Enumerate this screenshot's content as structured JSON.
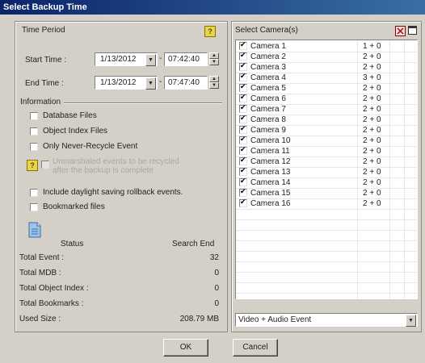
{
  "window": {
    "title": "Select Backup Time"
  },
  "time_period": {
    "title": "Time Period",
    "start_label": "Start Time :",
    "start_date": "1/13/2012",
    "start_time": "07:42:40",
    "end_label": "End Time :",
    "end_date": "1/13/2012",
    "end_time": "07:47:40"
  },
  "information": {
    "title": "Information",
    "options": [
      {
        "label": "Database Files",
        "checked": false
      },
      {
        "label": "Object Index Files",
        "checked": false
      },
      {
        "label": "Only Never-Recycle Event",
        "checked": false
      }
    ],
    "disabled_option": {
      "line1": "Unmarshaled events to be recycled",
      "line2": "after the backup is complete"
    },
    "daylight_label": "Include daylight saving rollback events.",
    "bookmarked_label": "Bookmarked files"
  },
  "status": {
    "col1": "Status",
    "col2": "Search End",
    "rows": [
      {
        "label": "Total Event :",
        "value": "32"
      },
      {
        "label": "Total MDB :",
        "value": "0"
      },
      {
        "label": "Total Object Index :",
        "value": "0"
      },
      {
        "label": "Total Bookmarks :",
        "value": "0"
      },
      {
        "label": "Used Size :",
        "value": "208.79 MB"
      }
    ]
  },
  "cameras": {
    "title": "Select Camera(s)",
    "list": [
      {
        "name": "Camera 1",
        "value": "1 + 0"
      },
      {
        "name": "Camera 2",
        "value": "2 + 0"
      },
      {
        "name": "Camera 3",
        "value": "2 + 0"
      },
      {
        "name": "Camera 4",
        "value": "3 + 0"
      },
      {
        "name": "Camera 5",
        "value": "2 + 0"
      },
      {
        "name": "Camera 6",
        "value": "2 + 0"
      },
      {
        "name": "Camera 7",
        "value": "2 + 0"
      },
      {
        "name": "Camera 8",
        "value": "2 + 0"
      },
      {
        "name": "Camera 9",
        "value": "2 + 0"
      },
      {
        "name": "Camera 10",
        "value": "2 + 0"
      },
      {
        "name": "Camera 11",
        "value": "2 + 0"
      },
      {
        "name": "Camera 12",
        "value": "2 + 0"
      },
      {
        "name": "Camera 13",
        "value": "2 + 0"
      },
      {
        "name": "Camera 14",
        "value": "2 + 0"
      },
      {
        "name": "Camera 15",
        "value": "2 + 0"
      },
      {
        "name": "Camera 16",
        "value": "2 + 0"
      }
    ],
    "filter_value": "Video + Audio Event"
  },
  "buttons": {
    "ok": "OK",
    "cancel": "Cancel"
  }
}
